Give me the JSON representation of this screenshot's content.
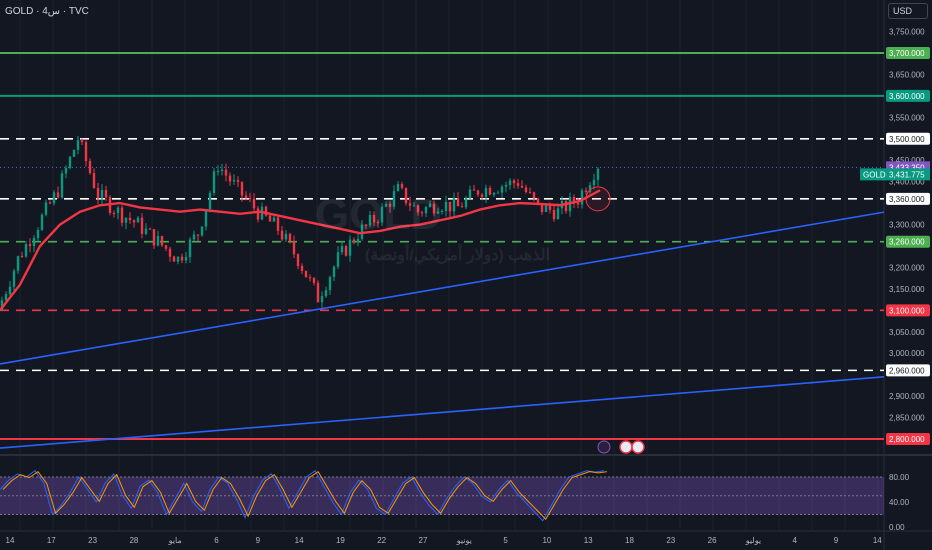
{
  "header": {
    "title": "GOLD · 4س · TVC",
    "currency": "USD"
  },
  "watermark": {
    "symbol": "GOLD",
    "description": "الذهب (دولار أمريكي/أونصة)"
  },
  "colors": {
    "background": "#131722",
    "candle_up": "#089981",
    "candle_down": "#f23645",
    "ma": "#f23645",
    "trend": "#2962ff",
    "rsi_band": "#7e57c2"
  },
  "chart_data": {
    "type": "candlestick",
    "symbol": "GOLD",
    "timeframe": "4h",
    "y_range": [
      2740,
      3780
    ],
    "price_ticks": [
      "3,750.000",
      "3,650.000",
      "3,550.000",
      "3,450.000",
      "3,400.000",
      "3,300.000",
      "3,200.000",
      "3,150.000",
      "3,050.000",
      "3,000.000",
      "2,900.000",
      "2,850.000"
    ],
    "price_tick_values": [
      3750,
      3650,
      3550,
      3450,
      3400,
      3300,
      3200,
      3150,
      3050,
      3000,
      2900,
      2850
    ],
    "x_ticks": [
      "14",
      "17",
      "23",
      "28",
      "مايو",
      "6",
      "9",
      "14",
      "19",
      "22",
      "27",
      "يونيو",
      "5",
      "10",
      "13",
      "18",
      "23",
      "26",
      "يوليو",
      "4",
      "9",
      "14"
    ],
    "closes": [
      3100,
      3220,
      3300,
      3380,
      3500,
      3370,
      3330,
      3300,
      3260,
      3220,
      3280,
      3440,
      3380,
      3330,
      3290,
      3220,
      3130,
      3220,
      3280,
      3320,
      3380,
      3330,
      3350,
      3340,
      3380,
      3390,
      3400,
      3340,
      3330,
      3360,
      3440
    ],
    "moving_average": [
      3100,
      3160,
      3250,
      3300,
      3330,
      3345,
      3350,
      3340,
      3335,
      3330,
      3335,
      3330,
      3325,
      3330,
      3320,
      3310,
      3300,
      3290,
      3280,
      3285,
      3295,
      3300,
      3310,
      3320,
      3335,
      3345,
      3350,
      3348,
      3345,
      3355,
      3380
    ],
    "levels": [
      {
        "price": 3700,
        "label": "3,700.000",
        "color": "#4caf50",
        "style": "solid"
      },
      {
        "price": 3600,
        "label": "3,600.000",
        "color": "#089981",
        "style": "solid"
      },
      {
        "price": 3500,
        "label": "3,500.000",
        "color": "#ffffff",
        "style": "dashed"
      },
      {
        "price": 3360,
        "label": "3,360.000",
        "color": "#ffffff",
        "style": "dashed"
      },
      {
        "price": 3260,
        "label": "3,260.000",
        "color": "#4caf50",
        "style": "dashed"
      },
      {
        "price": 3100,
        "label": "3,100.000",
        "color": "#f23645",
        "style": "dashed"
      },
      {
        "price": 2960,
        "label": "2,960.000",
        "color": "#ffffff",
        "style": "dashed"
      },
      {
        "price": 2800,
        "label": "2,800.000",
        "color": "#f23645",
        "style": "solid"
      }
    ],
    "trendlines": [
      {
        "from": 2975,
        "to": 3329
      },
      {
        "from": 2779,
        "to": 2945
      }
    ],
    "last_price": {
      "label": "3,433.350",
      "value": 3433.35,
      "color": "#7e57c2"
    },
    "symbol_price": {
      "symbol": "GOLD",
      "label": "3,431.775",
      "color": "#089981"
    },
    "rsi": {
      "ticks": [
        "80.00",
        "40.00",
        "0.00"
      ],
      "tick_values": [
        80,
        40,
        0
      ],
      "band": [
        20,
        80
      ],
      "values": [
        60,
        75,
        85,
        80,
        90,
        70,
        20,
        35,
        55,
        80,
        60,
        40,
        70,
        85,
        50,
        30,
        65,
        75,
        55,
        20,
        45,
        70,
        40,
        25,
        60,
        80,
        70,
        45,
        15,
        50,
        75,
        85,
        60,
        30,
        55,
        80,
        90,
        65,
        40,
        20,
        55,
        75,
        60,
        30,
        20,
        45,
        70,
        80,
        55,
        35,
        20,
        45,
        65,
        80,
        70,
        50,
        40,
        60,
        75,
        55,
        40,
        25,
        10,
        35,
        60,
        80,
        85,
        90,
        88,
        90
      ]
    }
  }
}
